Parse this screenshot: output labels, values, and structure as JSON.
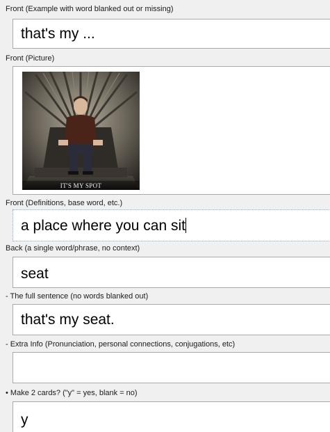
{
  "fields": [
    {
      "label": "Front (Example with word blanked out or missing)",
      "value": "that's my ..."
    },
    {
      "label": "Front (Picture)",
      "image_caption": "IT'S MY SPOT"
    },
    {
      "label": "Front (Definitions, base word, etc.)",
      "value": "a place where you can sit"
    },
    {
      "label": "Back (a single word/phrase, no context)",
      "value": "seat"
    },
    {
      "label": "- The full sentence (no words blanked out)",
      "value": "that's my seat."
    },
    {
      "label": "- Extra Info (Pronunciation, personal connections, conjugations, etc)",
      "value": ""
    },
    {
      "label": "• Make 2 cards? (\"y\" = yes, blank = no)",
      "value": "y"
    }
  ],
  "icons": {
    "picture": "throne-photo"
  },
  "colors": {
    "background": "#f0f0f0",
    "field_bg": "#ffffff",
    "field_border": "#a9a9a9",
    "focus_border": "#7aa6d6"
  }
}
